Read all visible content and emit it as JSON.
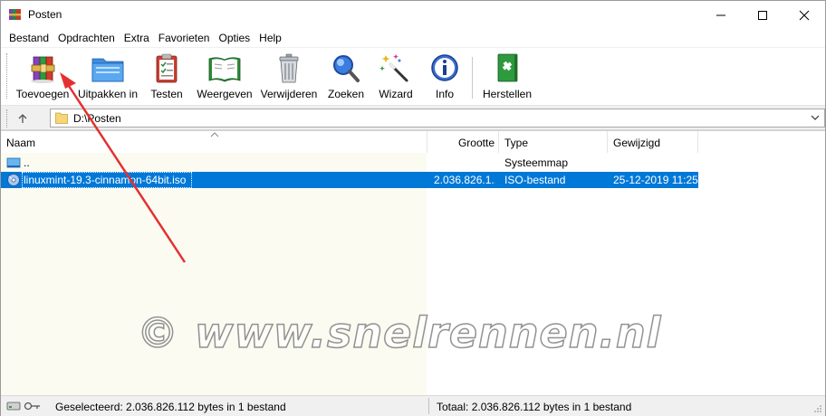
{
  "window": {
    "title": "Posten"
  },
  "menu": [
    "Bestand",
    "Opdrachten",
    "Extra",
    "Favorieten",
    "Opties",
    "Help"
  ],
  "toolbar": {
    "tools": [
      {
        "id": "toevoegen",
        "label": "Toevoegen",
        "icon": "books-add-icon"
      },
      {
        "id": "uitpakken",
        "label": "Uitpakken in",
        "icon": "folder-extract-icon"
      },
      {
        "id": "testen",
        "label": "Testen",
        "icon": "clipboard-check-icon"
      },
      {
        "id": "weergeven",
        "label": "Weergeven",
        "icon": "open-book-icon"
      },
      {
        "id": "verwijderen",
        "label": "Verwijderen",
        "icon": "trash-can-icon"
      },
      {
        "id": "zoeken",
        "label": "Zoeken",
        "icon": "magnifier-icon"
      },
      {
        "id": "wizard",
        "label": "Wizard",
        "icon": "magic-wand-icon"
      },
      {
        "id": "info",
        "label": "Info",
        "icon": "info-icon"
      },
      {
        "id": "herstellen",
        "label": "Herstellen",
        "icon": "first-aid-book-icon"
      }
    ]
  },
  "address": {
    "path": "D:\\Posten"
  },
  "columns": {
    "name": "Naam",
    "size": "Grootte",
    "type": "Type",
    "modified": "Gewijzigd"
  },
  "rows": [
    {
      "name": "..",
      "size": "",
      "type": "Systeemmap",
      "modified": ""
    },
    {
      "name": "linuxmint-19.3-cinnamon-64bit.iso",
      "size": "2.036.826.1...",
      "type": "ISO-bestand",
      "modified": "25-12-2019 11:25"
    }
  ],
  "watermark": "© www.snelrennen.nl",
  "status": {
    "left": "Geselecteerd: 2.036.826.112 bytes in 1 bestand",
    "right": "Totaal: 2.036.826.112 bytes in 1 bestand"
  },
  "colors": {
    "selection": "#0078d7",
    "annotation_arrow": "#e53030"
  }
}
